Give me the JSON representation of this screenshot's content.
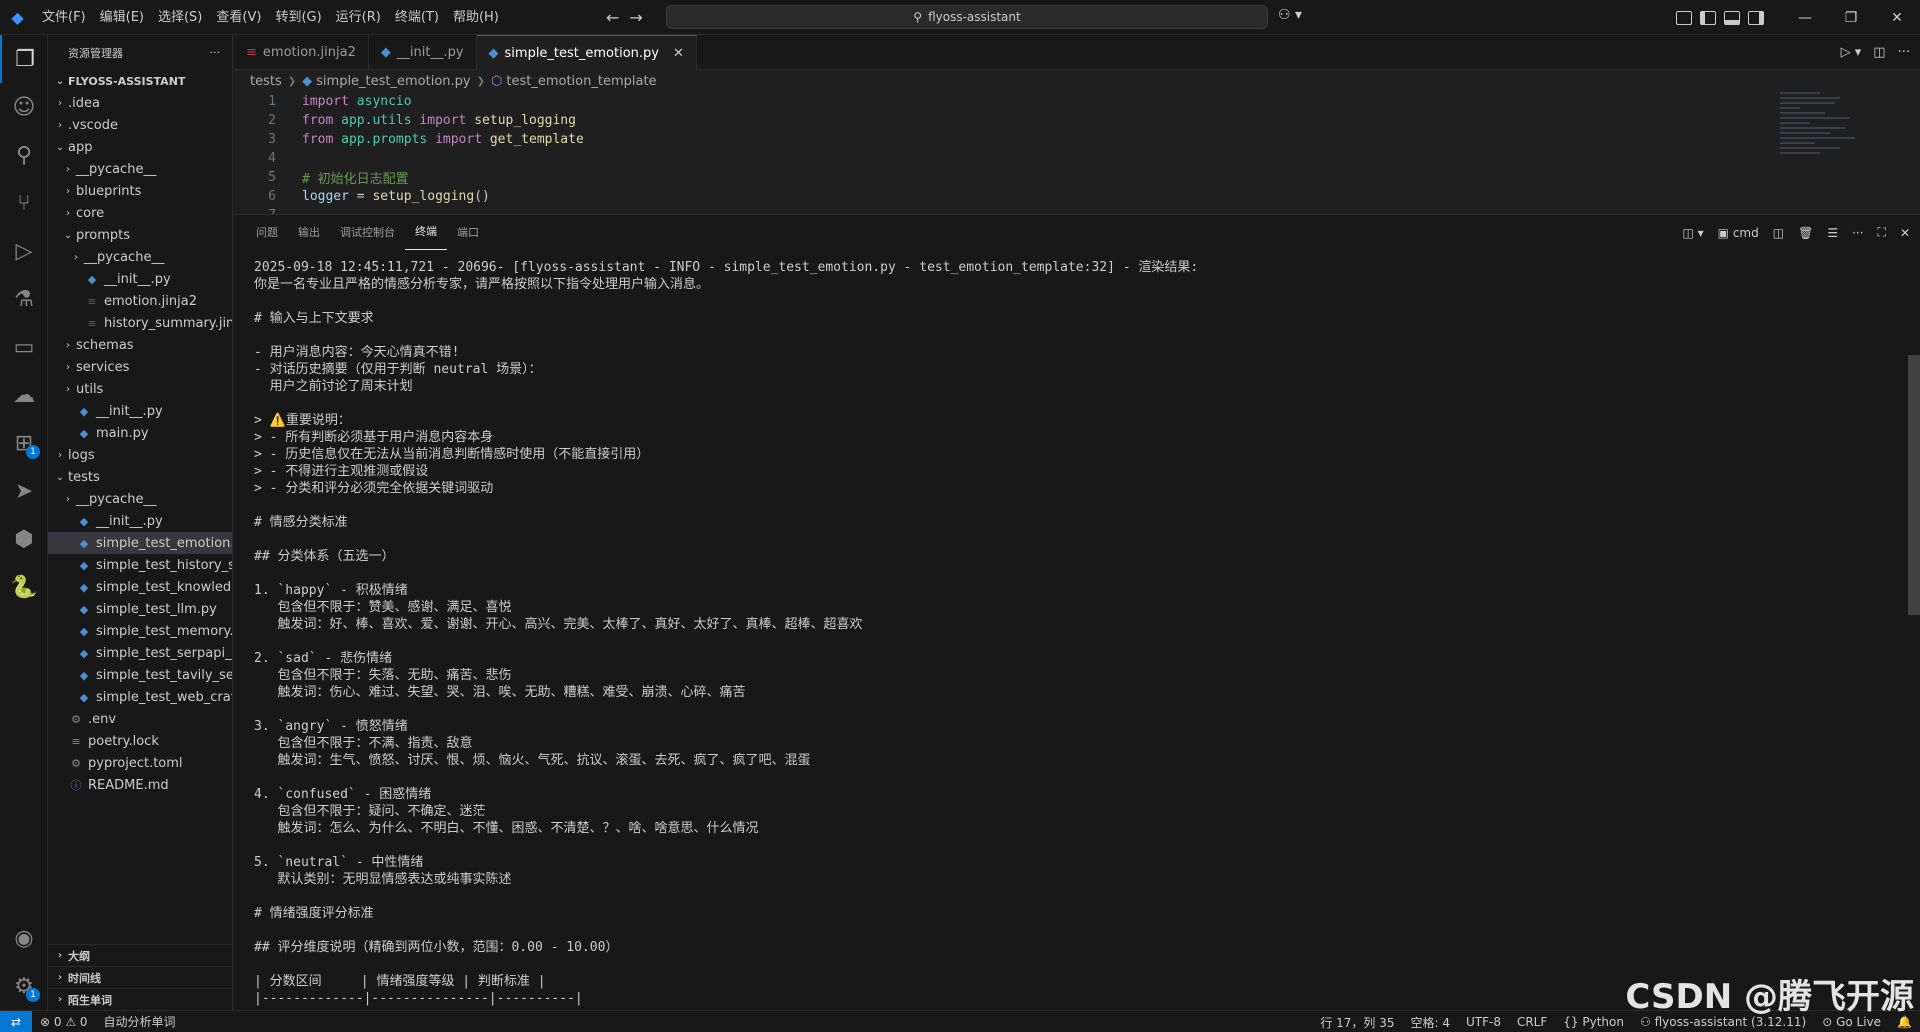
{
  "titlebar": {
    "menu": [
      "文件(F)",
      "编辑(E)",
      "选择(S)",
      "查看(V)",
      "转到(G)",
      "运行(R)",
      "终端(T)",
      "帮助(H)"
    ],
    "search_text": "flyoss-assistant",
    "back_icon": "arrow-left-icon",
    "forward_icon": "arrow-right-icon"
  },
  "activity_bar": {
    "items": [
      "explorer",
      "copilot",
      "search",
      "source-control",
      "run-debug",
      "testing",
      "remote-explorer",
      "extensions-cloud",
      "extensions",
      "deploy",
      "containers",
      "python"
    ],
    "extensions_badge": "1",
    "settings_badge": "1"
  },
  "sidebar": {
    "title": "资源管理器",
    "more": "···",
    "root": "FLYOSS-ASSISTANT",
    "tree": [
      {
        "label": ".idea",
        "depth": 1,
        "type": "folder",
        "open": false
      },
      {
        "label": ".vscode",
        "depth": 1,
        "type": "folder",
        "open": false
      },
      {
        "label": "app",
        "depth": 1,
        "type": "folder",
        "open": true
      },
      {
        "label": "__pycache__",
        "depth": 2,
        "type": "folder",
        "open": false
      },
      {
        "label": "blueprints",
        "depth": 2,
        "type": "folder",
        "open": false
      },
      {
        "label": "core",
        "depth": 2,
        "type": "folder",
        "open": false
      },
      {
        "label": "prompts",
        "depth": 2,
        "type": "folder",
        "open": true
      },
      {
        "label": "__pycache__",
        "depth": 3,
        "type": "folder",
        "open": false
      },
      {
        "label": "__init__.py",
        "depth": 3,
        "type": "py"
      },
      {
        "label": "emotion.jinja2",
        "depth": 3,
        "type": "jinja"
      },
      {
        "label": "history_summary.jinja2",
        "depth": 3,
        "type": "jinja"
      },
      {
        "label": "schemas",
        "depth": 2,
        "type": "folder",
        "open": false
      },
      {
        "label": "services",
        "depth": 2,
        "type": "folder",
        "open": false
      },
      {
        "label": "utils",
        "depth": 2,
        "type": "folder",
        "open": false
      },
      {
        "label": "__init__.py",
        "depth": 2,
        "type": "py"
      },
      {
        "label": "main.py",
        "depth": 2,
        "type": "py"
      },
      {
        "label": "logs",
        "depth": 1,
        "type": "folder",
        "open": false
      },
      {
        "label": "tests",
        "depth": 1,
        "type": "folder",
        "open": true
      },
      {
        "label": "__pycache__",
        "depth": 2,
        "type": "folder",
        "open": false
      },
      {
        "label": "__init__.py",
        "depth": 2,
        "type": "py"
      },
      {
        "label": "simple_test_emotion.py",
        "depth": 2,
        "type": "py",
        "selected": true
      },
      {
        "label": "simple_test_history_su...",
        "depth": 2,
        "type": "py"
      },
      {
        "label": "simple_test_knowledge...",
        "depth": 2,
        "type": "py"
      },
      {
        "label": "simple_test_llm.py",
        "depth": 2,
        "type": "py"
      },
      {
        "label": "simple_test_memory.py",
        "depth": 2,
        "type": "py"
      },
      {
        "label": "simple_test_serpapi_se...",
        "depth": 2,
        "type": "py"
      },
      {
        "label": "simple_test_tavily_servi...",
        "depth": 2,
        "type": "py"
      },
      {
        "label": "simple_test_web_crawl...",
        "depth": 2,
        "type": "py"
      },
      {
        "label": ".env",
        "depth": 1,
        "type": "gear"
      },
      {
        "label": "poetry.lock",
        "depth": 1,
        "type": "list"
      },
      {
        "label": "pyproject.toml",
        "depth": 1,
        "type": "gear"
      },
      {
        "label": "README.md",
        "depth": 1,
        "type": "info"
      }
    ],
    "bottom_sections": [
      "大纲",
      "时间线",
      "陌生单词"
    ]
  },
  "tabs": [
    {
      "label": "emotion.jinja2",
      "type": "jinja",
      "active": false
    },
    {
      "label": "__init__.py",
      "type": "py",
      "active": false
    },
    {
      "label": "simple_test_emotion.py",
      "type": "py",
      "active": true
    }
  ],
  "breadcrumb": [
    "tests",
    "simple_test_emotion.py",
    "test_emotion_template"
  ],
  "editor": {
    "lines": [
      {
        "n": "1",
        "tokens": [
          [
            "kw",
            "import"
          ],
          [
            "plain",
            " "
          ],
          [
            "mod",
            "asyncio"
          ]
        ]
      },
      {
        "n": "2",
        "tokens": [
          [
            "kw",
            "from"
          ],
          [
            "plain",
            " "
          ],
          [
            "mod",
            "app.utils"
          ],
          [
            "plain",
            " "
          ],
          [
            "kw",
            "import"
          ],
          [
            "plain",
            " "
          ],
          [
            "fn",
            "setup_logging"
          ]
        ]
      },
      {
        "n": "3",
        "tokens": [
          [
            "kw",
            "from"
          ],
          [
            "plain",
            " "
          ],
          [
            "mod",
            "app.prompts"
          ],
          [
            "plain",
            " "
          ],
          [
            "kw",
            "import"
          ],
          [
            "plain",
            " "
          ],
          [
            "fn",
            "get_template"
          ]
        ]
      },
      {
        "n": "4",
        "tokens": []
      },
      {
        "n": "5",
        "tokens": [
          [
            "cmt",
            "# 初始化日志配置"
          ]
        ]
      },
      {
        "n": "6",
        "tokens": [
          [
            "var",
            "logger"
          ],
          [
            "plain",
            " = "
          ],
          [
            "fn",
            "setup_logging"
          ],
          [
            "plain",
            "()"
          ]
        ]
      },
      {
        "n": "7",
        "tokens": []
      }
    ]
  },
  "panel": {
    "tabs": [
      "问题",
      "输出",
      "调试控制台",
      "终端",
      "端口"
    ],
    "active_tab": "终端",
    "shell": "cmd",
    "terminal_lines": [
      "2025-09-18 12:45:11,721 - 20696- [flyoss-assistant - INFO - simple_test_emotion.py - test_emotion_template:32] - 渲染结果:",
      "你是一名专业且严格的情感分析专家，请严格按照以下指令处理用户输入消息。",
      "",
      "# 输入与上下文要求",
      "",
      "- 用户消息内容：今天心情真不错!",
      "- 对话历史摘要（仅用于判断 neutral 场景）：",
      "  用户之前讨论了周末计划",
      "",
      "> ⚠️重要说明：",
      "> - 所有判断必须基于用户消息内容本身",
      "> - 历史信息仅在无法从当前消息判断情感时使用（不能直接引用）",
      "> - 不得进行主观推测或假设",
      "> - 分类和评分必须完全依据关键词驱动",
      "",
      "# 情感分类标准",
      "",
      "## 分类体系（五选一）",
      "",
      "1. `happy` - 积极情绪",
      "   包含但不限于：赞美、感谢、满足、喜悦",
      "   触发词：好、棒、喜欢、爱、谢谢、开心、高兴、完美、太棒了、真好、太好了、真棒、超棒、超喜欢",
      "",
      "2. `sad` - 悲伤情绪",
      "   包含但不限于：失落、无助、痛苦、悲伤",
      "   触发词：伤心、难过、失望、哭、泪、唉、无助、糟糕、难受、崩溃、心碎、痛苦",
      "",
      "3. `angry` - 愤怒情绪",
      "   包含但不限于：不满、指责、敌意",
      "   触发词：生气、愤怒、讨厌、恨、烦、恼火、气死、抗议、滚蛋、去死、疯了、疯了吧、混蛋",
      "",
      "4. `confused` - 困惑情绪",
      "   包含但不限于：疑问、不确定、迷茫",
      "   触发词：怎么、为什么、不明白、不懂、困惑、不清楚、？、啥、啥意思、什么情况",
      "",
      "5. `neutral` - 中性情绪",
      "   默认类别：无明显情感表达或纯事实陈述",
      "",
      "# 情绪强度评分标准",
      "",
      "## 评分维度说明（精确到两位小数，范围：0.00 - 10.00）",
      "",
      "| 分数区间     | 情绪强度等级 | 判断标准 |",
      "|-------------|---------------|----------|"
    ]
  },
  "statusbar": {
    "errors": "0",
    "warnings": "0",
    "left_text": "自动分析单词",
    "position": "行 17，列 35",
    "spaces": "空格: 4",
    "encoding": "UTF-8",
    "eol": "CRLF",
    "language": "Python",
    "interpreter": "flyoss-assistant (3.12.11)",
    "golive": "Go Live"
  },
  "watermark": "CSDN @腾飞开源"
}
